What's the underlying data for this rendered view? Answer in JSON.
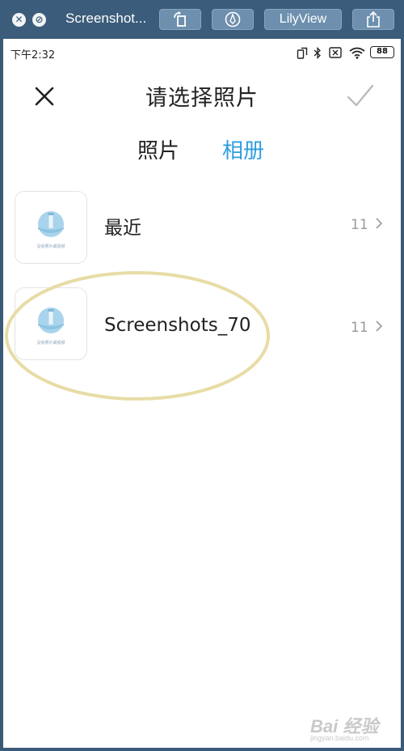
{
  "viewer": {
    "window_title": "Screenshot...",
    "rotate_icon": "rotate-left-icon",
    "markup_icon": "pen-markup-icon",
    "app_button": "LilyView",
    "share_icon": "share-icon"
  },
  "status_bar": {
    "time": "下午2:32",
    "battery": "88"
  },
  "header": {
    "title": "请选择照片",
    "close_icon": "close-icon",
    "confirm_icon": "checkmark-icon"
  },
  "tabs": [
    {
      "label": "照片",
      "active": false
    },
    {
      "label": "相册",
      "active": true
    }
  ],
  "albums": [
    {
      "name": "最近",
      "count": "11",
      "thumb_caption": "没有照片或视频"
    },
    {
      "name": "Screenshots_70",
      "count": "11",
      "thumb_caption": "没有照片或视频"
    }
  ],
  "watermark": {
    "main": "Bai 经验",
    "sub": "jingyan.baidu.com"
  },
  "colors": {
    "accent": "#2e9ee0",
    "viewer_bar": "#3b5c7a",
    "highlight": "#e8dca6"
  }
}
